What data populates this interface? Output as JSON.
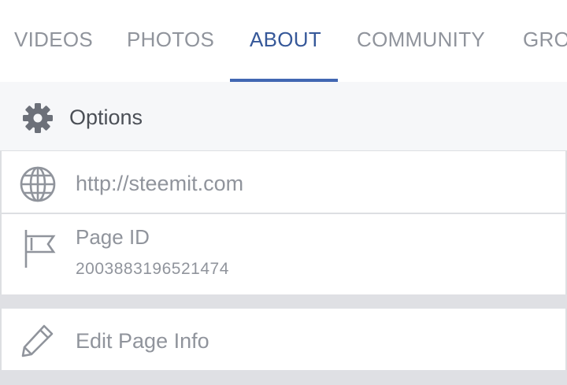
{
  "tabs": [
    {
      "label": "VIDEOS",
      "active": false
    },
    {
      "label": "PHOTOS",
      "active": false
    },
    {
      "label": "ABOUT",
      "active": true
    },
    {
      "label": "COMMUNITY",
      "active": false
    },
    {
      "label": "GROUPS",
      "active": false
    }
  ],
  "options": {
    "label": "Options",
    "icon": "gear-icon"
  },
  "about": {
    "website": {
      "icon": "globe-icon",
      "value": "http://steemit.com"
    },
    "page_id": {
      "icon": "flag-icon",
      "label": "Page ID",
      "value": "2003883196521474"
    }
  },
  "edit": {
    "icon": "pencil-icon",
    "label": "Edit Page Info"
  },
  "colors": {
    "accent": "#4267b2",
    "active_tab_text": "#365899",
    "muted_text": "#90949c",
    "background": "#dfe0e4"
  }
}
